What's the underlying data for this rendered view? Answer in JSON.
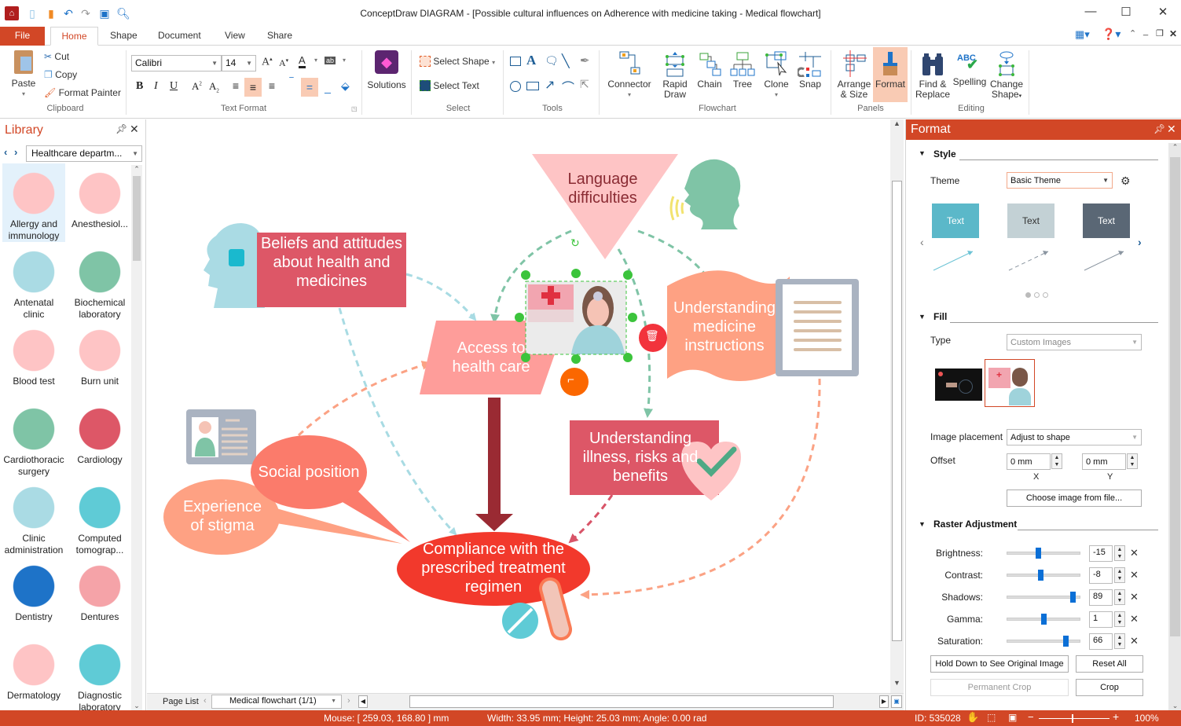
{
  "window": {
    "title": "ConceptDraw DIAGRAM - [Possible cultural influences on Adherence with medicine taking - Medical flowchart]",
    "controls": [
      "minimize-icon",
      "maximize-icon",
      "close-icon"
    ]
  },
  "quick_access": [
    "app-icon",
    "new-file-icon",
    "open-file-icon",
    "undo-icon",
    "redo-icon",
    "save-icon",
    "print-preview-icon"
  ],
  "tabs": [
    {
      "label": "File"
    },
    {
      "label": "Home",
      "active": true
    },
    {
      "label": "Shape"
    },
    {
      "label": "Document"
    },
    {
      "label": "View"
    },
    {
      "label": "Share"
    }
  ],
  "ribbon": {
    "clipboard": {
      "paste": "Paste",
      "cut": "Cut",
      "copy": "Copy",
      "format_painter": "Format Painter",
      "group": "Clipboard"
    },
    "text_format": {
      "font": "Calibri",
      "size": "14",
      "group": "Text Format"
    },
    "solutions": {
      "label": "Solutions"
    },
    "select": {
      "select_shape": "Select Shape",
      "select_text": "Select Text",
      "group": "Select"
    },
    "tools": {
      "group": "Tools"
    },
    "flowchart": {
      "connector": "Connector",
      "rapid_draw_1": "Rapid",
      "rapid_draw_2": "Draw",
      "chain": "Chain",
      "tree": "Tree",
      "clone": "Clone",
      "snap": "Snap",
      "group": "Flowchart"
    },
    "panels": {
      "arrange_1": "Arrange",
      "arrange_2": "& Size",
      "format": "Format",
      "group": "Panels"
    },
    "editing": {
      "find_1": "Find &",
      "find_2": "Replace",
      "spelling": "Spelling",
      "change_1": "Change",
      "change_2": "Shape",
      "group": "Editing"
    }
  },
  "library": {
    "title": "Library",
    "dropdown": "Healthcare departm...",
    "items": [
      {
        "label": "Allergy and immunology",
        "selected": true
      },
      {
        "label": "Anesthesiol..."
      },
      {
        "label": "Antenatal clinic"
      },
      {
        "label": "Biochemical laboratory"
      },
      {
        "label": "Blood test"
      },
      {
        "label": "Burn unit"
      },
      {
        "label": "Cardiothoracic surgery"
      },
      {
        "label": "Cardiology"
      },
      {
        "label": "Clinic administration"
      },
      {
        "label": "Computed tomograp..."
      },
      {
        "label": "Dentistry"
      },
      {
        "label": "Dentures"
      },
      {
        "label": "Dermatology"
      },
      {
        "label": "Diagnostic laboratory"
      }
    ]
  },
  "diagram": {
    "beliefs": "Beliefs and attitudes about health and medicines",
    "language": "Language difficulties",
    "access": "Access to health care",
    "understanding_instructions": "Understanding medicine instructions",
    "understanding_illness": "Understanding illness, risks and benefits",
    "social": "Social position",
    "stigma": "Experience of stigma",
    "compliance": "Compliance with the prescribed treatment regimen"
  },
  "page_bar": {
    "label": "Page List",
    "page": "Medical flowchart (1/1)"
  },
  "format_panel": {
    "title": "Format",
    "style": {
      "heading": "Style",
      "theme_label": "Theme",
      "theme_value": "Basic Theme",
      "swatches": [
        {
          "label": "Text",
          "color": "#5bb8c9"
        },
        {
          "label": "Text",
          "color": "#c3d1d5"
        },
        {
          "label": "Text",
          "color": "#5a6775"
        }
      ],
      "page_dots": 3,
      "active_dot": 1
    },
    "fill": {
      "heading": "Fill",
      "type_label": "Type",
      "type_value": "Custom Images",
      "placement_label": "Image placement",
      "placement_value": "Adjust to shape",
      "offset_label": "Offset",
      "offset_x": "0 mm",
      "offset_y": "0 mm",
      "x_label": "X",
      "y_label": "Y",
      "choose_button": "Choose image from file..."
    },
    "raster": {
      "heading": "Raster Adjustment",
      "rows": [
        {
          "label": "Brightness:",
          "value": "-15",
          "fraction": 0.42
        },
        {
          "label": "Contrast:",
          "value": "-8",
          "fraction": 0.46
        },
        {
          "label": "Shadows:",
          "value": "89",
          "fraction": 0.92
        },
        {
          "label": "Gamma:",
          "value": "1",
          "fraction": 0.5
        },
        {
          "label": "Saturation:",
          "value": "66",
          "fraction": 0.82
        }
      ],
      "hold_button": "Hold Down to See Original Image",
      "reset_button": "Reset All",
      "permanent_crop": "Permanent Crop",
      "crop": "Crop"
    }
  },
  "status": {
    "mouse": "Mouse: [ 259.03, 168.80 ] mm",
    "dims": "Width: 33.95 mm;  Height: 25.03 mm;  Angle: 0.00 rad",
    "id": "ID: 535028",
    "zoom": "100%"
  }
}
